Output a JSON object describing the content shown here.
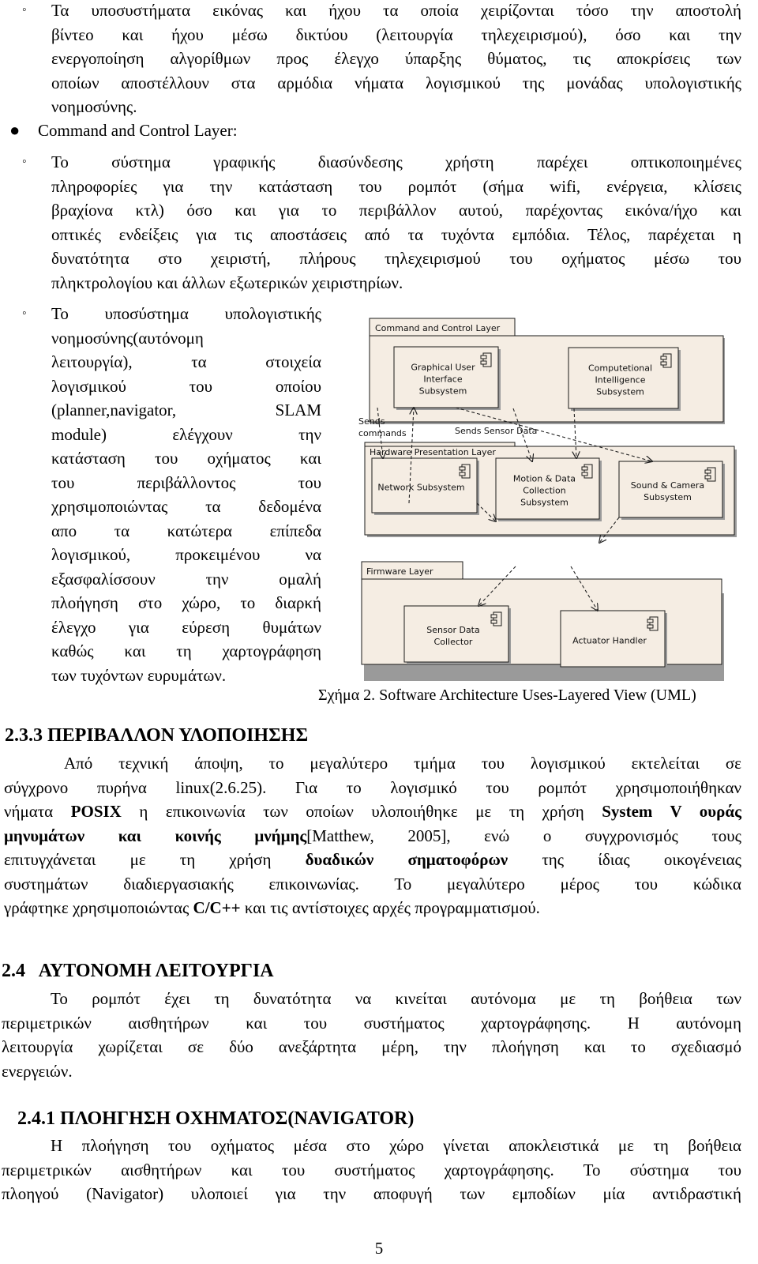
{
  "section_prev": {
    "items": [
      {
        "lines": [
          "Τα υποσυστήματα εικόνας και ήχου τα οποία χειρίζονται τόσο την αποστολή",
          "βίντεο και ήχου μέσω δικτύου (λειτουργία τηλεχειρισμού), όσο και την",
          "ενεργοποίηση αλγορίθμων προς έλεγχο ύπαρξης θύματος, τις αποκρίσεις των",
          "οποίων αποστέλλουν στα αρμόδια νήματα λογισμικού της μονάδας υπολογιστικής",
          "νοημοσύνης."
        ]
      }
    ]
  },
  "command_layer": {
    "bullet_label": "Command and Control Layer:",
    "gui_item": {
      "lines": [
        "Το σύστημα γραφικής διασύνδεσης χρήστη παρέχει οπτικοποιημένες",
        "πληροφορίες για την κατάσταση του ρομπότ (σήμα wifi, ενέργεια, κλίσεις",
        "βραχίονα κτλ) όσο και για το περιβάλλον αυτού, παρέχοντας εικόνα/ήχο και",
        "οπτικές ενδείξεις για τις αποστάσεις από τα τυχόντα εμπόδια. Τέλος, παρέχεται η",
        "δυνατότητα στο χειριστή, πλήρους τηλεχειρισμού του οχήματος μέσω του",
        "πληκτρολογίου και άλλων εξωτερικών χειριστηρίων."
      ]
    },
    "ci_item": {
      "lines": [
        "Το υποσύστημα υπολογιστικής",
        "νοημοσύνης(αυτόνομη",
        "λειτουργία), τα στοιχεία",
        "λογισμικού του οποίου",
        "(planner,navigator, SLAM",
        "module) ελέγχουν την",
        "κατάσταση του οχήματος και",
        "του περιβάλλοντος του",
        "χρησιμοποιώντας τα δεδομένα",
        "απο τα κατώτερα επίπεδα",
        "λογισμικού, προκειμένου να",
        "εξασφαλίσσουν την ομαλή",
        "πλοήγηση στο χώρο, το διαρκή",
        "έλεγχο για εύρεση θυμάτων",
        "καθώς και τη χαρτογράφηση",
        "των τυχόντων ευρυμάτων."
      ]
    }
  },
  "diagram": {
    "caption": "Σχήμα 2. Software Architecture Uses-Layered View (UML)",
    "colors": {
      "fill": "#f5ede3",
      "stroke": "#1a1a1a",
      "shadow": "#9a9a9a"
    },
    "layers": [
      {
        "id": "ccl",
        "title": "Command and Control Layer"
      },
      {
        "id": "hpl",
        "title": "Hardware Presentation Layer"
      },
      {
        "id": "fwl",
        "title": "Firmware Layer"
      }
    ],
    "components": [
      {
        "id": "gui",
        "lines": [
          "Graphical User",
          "Interface",
          "Subsystem"
        ]
      },
      {
        "id": "cis",
        "lines": [
          "Computetional",
          "Intelligence",
          "Subsystem"
        ]
      },
      {
        "id": "net",
        "lines": [
          "Network Subsystem"
        ]
      },
      {
        "id": "mdc",
        "lines": [
          "Motion & Data",
          "Collection",
          "Subsystem"
        ]
      },
      {
        "id": "scs",
        "lines": [
          "Sound & Camera",
          "Subsystem"
        ]
      },
      {
        "id": "sdc",
        "lines": [
          "Sensor Data",
          "Collector"
        ]
      },
      {
        "id": "act",
        "lines": [
          "Actuator Handler"
        ]
      }
    ],
    "labels": {
      "sends_commands_1": "Sends",
      "sends_commands_2": "commands",
      "sends_sensor_data": "Sends Sensor Data"
    }
  },
  "section_233": {
    "heading": "2.3.3 ΠΕΡΙΒΑΛΛΟΝ ΥΛΟΠΟΙΗΣΗΣ",
    "p1_line1": "Από τεχνική άποψη, το μεγαλύτερο τμήμα του λογισμικού εκτελείται σε",
    "p1_line2": "σύγχρονο πυρήνα linux(2.6.25). Για το λογισμικό του ρομπότ χρησιμοποιήθηκαν",
    "l3_a": "νήματα ",
    "l3_b": "POSIX",
    "l3_c": " η επικοινωνία των οποίων υλοποιήθηκε με τη χρήση ",
    "l3_d": "System V ουράς",
    "l4_a": "μηνυμάτων και κοινής μνήμης",
    "l4_b": "[Matthew, 2005], ενώ ο συγχρονισμός τους",
    "l5_a": "επιτυγχάνεται με τη χρήση ",
    "l5_b": "δυαδικών σηματοφόρων",
    "l5_c": " της ίδιας οικογένειας",
    "l6": "συστημάτων διαδιεργασιακής επικοινωνίας. Το μεγαλύτερο μέρος του κώδικα",
    "l7_a": "γράφτηκε χρησιμοποιώντας ",
    "l7_b": "C/C++",
    "l7_c": " και τις αντίστοιχες αρχές προγραμματισμού."
  },
  "section_24": {
    "heading": "2.4   ΑΥΤΟΝΟΜΗ ΛΕΙΤΟΥΡΓΙΑ",
    "lines": [
      "Το ρομπότ έχει τη δυνατότητα να κινείται αυτόνομα με τη βοήθεια των",
      "περιμετρικών αισθητήρων και του συστήματος χαρτογράφησης. Η αυτόνομη",
      "λειτουργία χωρίζεται σε δύο ανεξάρτητα μέρη, την πλοήγηση και το σχεδιασμό",
      "ενεργειών."
    ]
  },
  "section_241": {
    "heading": "2.4.1 ΠΛΟΗΓΗΣΗ ΟΧΗΜΑΤΟΣ(NAVIGATOR)",
    "lines": [
      "Η πλοήγηση του οχήματος μέσα στο χώρο γίνεται αποκλειστικά με τη βοήθεια",
      "περιμετρικών αισθητήρων και του συστήματος χαρτογράφησης. Το σύστημα του",
      "πλοηγού (Navigator) υλοποιεί για την αποφυγή των εμποδίων μία αντιδραστική"
    ]
  },
  "page_number": "5"
}
